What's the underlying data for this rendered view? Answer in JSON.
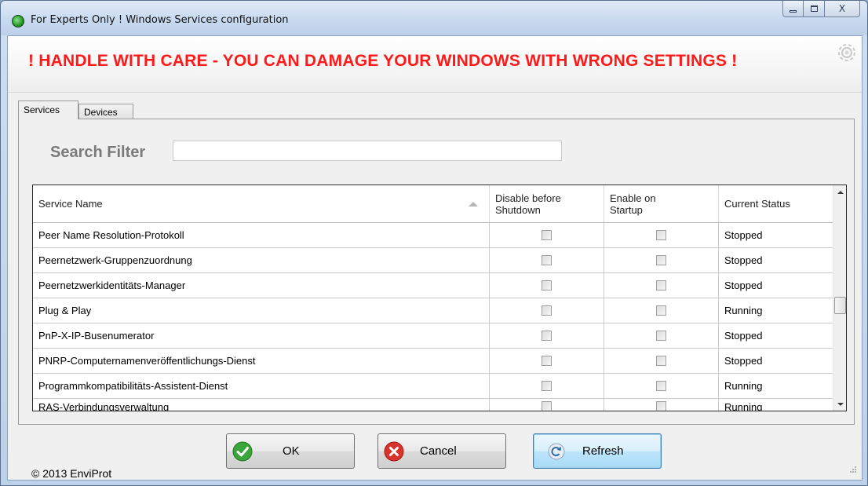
{
  "window": {
    "title": "For Experts Only ! Windows Services configuration",
    "controls": {
      "minimize": "▭",
      "maximize": "▣",
      "close": "X"
    }
  },
  "warning": "! HANDLE WITH CARE - YOU CAN DAMAGE YOUR WINDOWS WITH WRONG SETTINGS !",
  "tabs": [
    {
      "label": "Services",
      "active": true
    },
    {
      "label": "Devices",
      "active": false
    }
  ],
  "search": {
    "label": "Search Filter",
    "value": "",
    "placeholder": ""
  },
  "grid": {
    "columns": [
      "Service Name",
      "Disable before Shutdown",
      "Enable on Startup",
      "Current Status"
    ],
    "rows": [
      {
        "name": "Peer Name Resolution-Protokoll",
        "disable_before_shutdown": false,
        "enable_on_startup": false,
        "status": "Stopped"
      },
      {
        "name": "Peernetzwerk-Gruppenzuordnung",
        "disable_before_shutdown": false,
        "enable_on_startup": false,
        "status": "Stopped"
      },
      {
        "name": "Peernetzwerkidentitäts-Manager",
        "disable_before_shutdown": false,
        "enable_on_startup": false,
        "status": "Stopped"
      },
      {
        "name": "Plug & Play",
        "disable_before_shutdown": false,
        "enable_on_startup": false,
        "status": "Running"
      },
      {
        "name": "PnP-X-IP-Busenumerator",
        "disable_before_shutdown": false,
        "enable_on_startup": false,
        "status": "Stopped"
      },
      {
        "name": "PNRP-Computernamenveröffentlichungs-Dienst",
        "disable_before_shutdown": false,
        "enable_on_startup": false,
        "status": "Stopped"
      },
      {
        "name": "Programmkompatibilitäts-Assistent-Dienst",
        "disable_before_shutdown": false,
        "enable_on_startup": false,
        "status": "Running"
      },
      {
        "name": "RAS-Verbindungsverwaltung",
        "disable_before_shutdown": false,
        "enable_on_startup": false,
        "status": "Running"
      }
    ]
  },
  "footer": {
    "copyright": "© 2013 EnviProt",
    "ok_label": "OK",
    "cancel_label": "Cancel",
    "refresh_label": "Refresh"
  },
  "colors": {
    "warning_text": "#ff1a1a",
    "ok_icon": "#3aa53a",
    "cancel_icon": "#d9342b",
    "refresh_icon": "#2f6fa8"
  },
  "icons": {
    "app": "green-circle-icon",
    "settings": "gear-icon",
    "ok": "check-icon",
    "cancel": "x-icon",
    "refresh": "refresh-icon"
  }
}
